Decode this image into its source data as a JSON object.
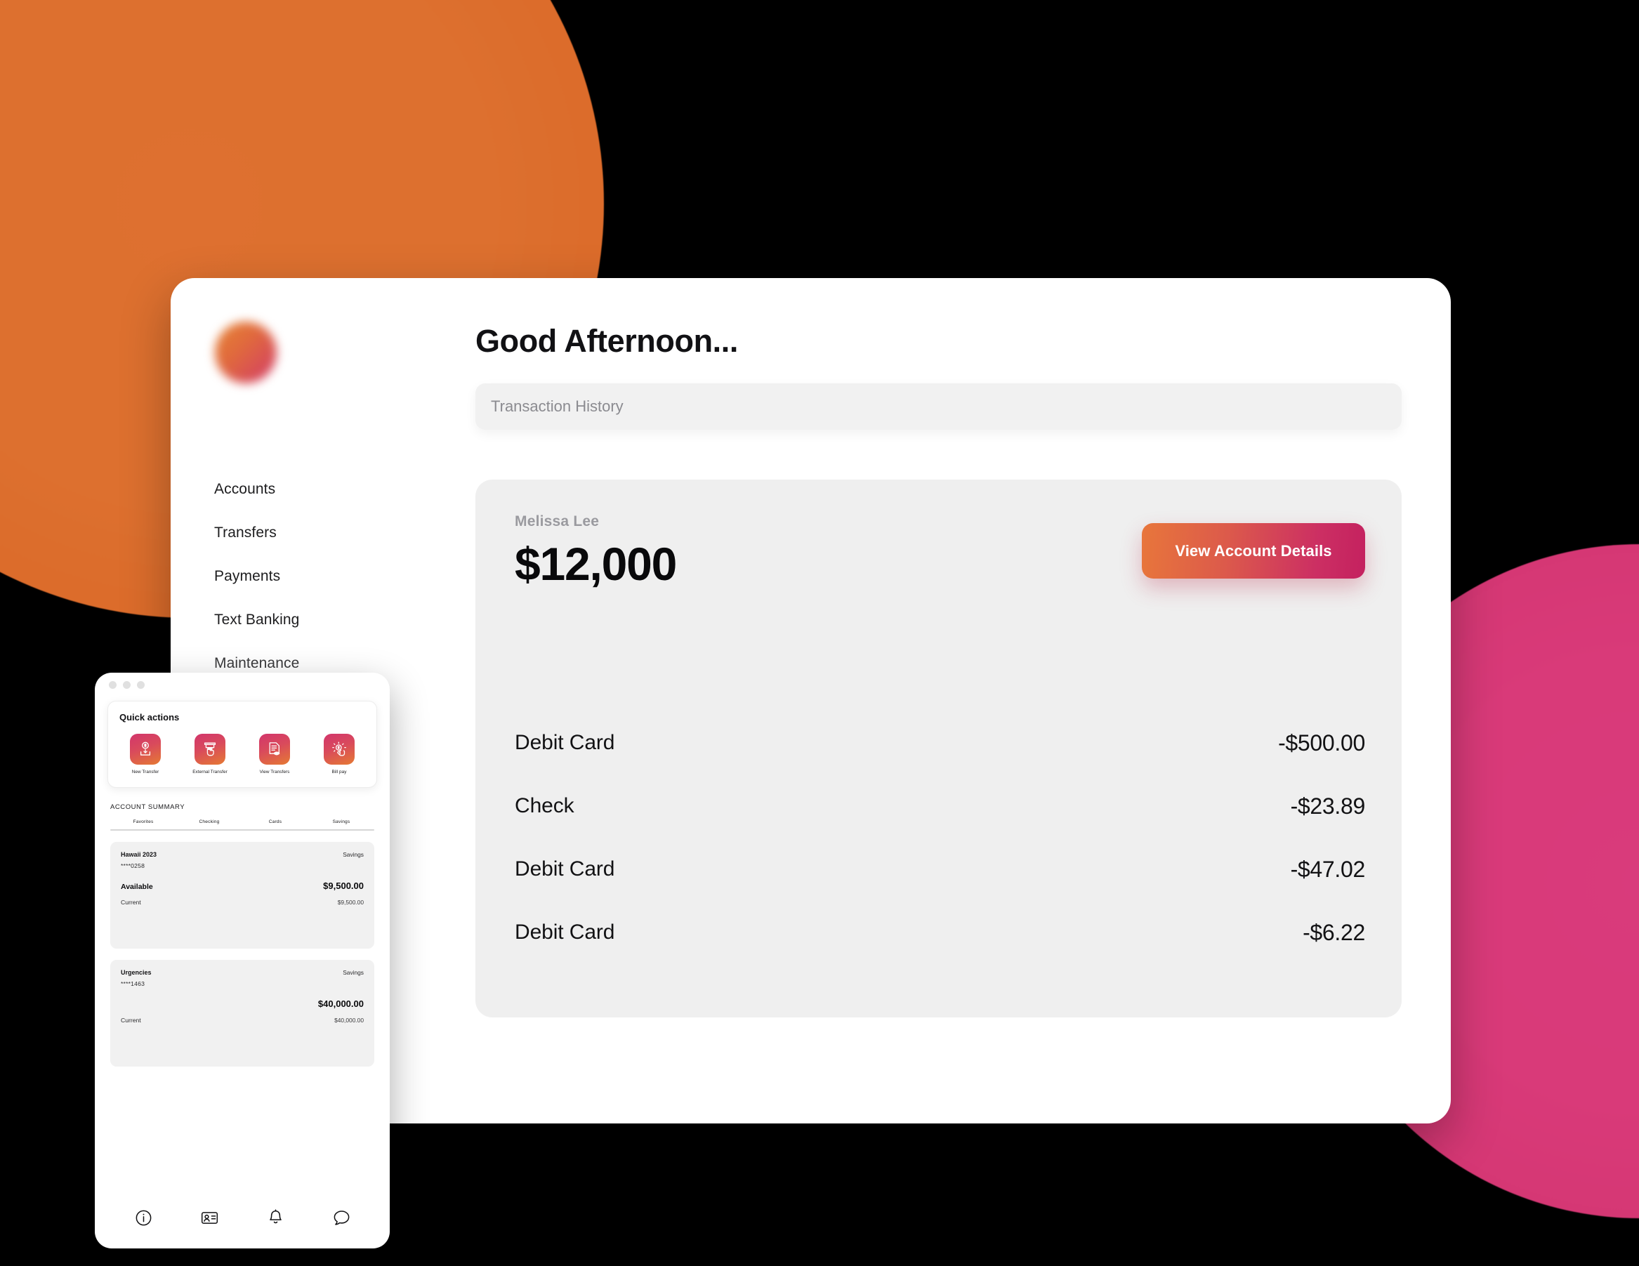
{
  "background": {
    "orange_blob_color": "#DE7030",
    "pink_blob_color": "#D93B7C",
    "page_color": "#000000"
  },
  "desktop": {
    "sidebar": {
      "avatar_name": "brand-avatar",
      "items": [
        {
          "label": "Accounts"
        },
        {
          "label": "Transfers"
        },
        {
          "label": "Payments"
        },
        {
          "label": "Text Banking"
        },
        {
          "label": "Maintenance"
        }
      ]
    },
    "greeting": "Good Afternoon...",
    "search": {
      "placeholder": "Transaction History",
      "value": ""
    },
    "account": {
      "owner": "Melissa Lee",
      "balance": "$12,000",
      "details_button": "View Account Details",
      "button_gradient_from": "#E8763B",
      "button_gradient_to": "#C4215F"
    },
    "transactions": [
      {
        "label": "Debit Card",
        "amount": "-$500.00"
      },
      {
        "label": "Check",
        "amount": "-$23.89"
      },
      {
        "label": "Debit Card",
        "amount": "-$47.02"
      },
      {
        "label": "Debit Card",
        "amount": "-$6.22"
      }
    ]
  },
  "mobile": {
    "quick_actions": {
      "title": "Quick actions",
      "items": [
        {
          "label": "New Transfer",
          "icon": "money-download-icon"
        },
        {
          "label": "External Transfer",
          "icon": "atm-hand-icon"
        },
        {
          "label": "View Transfers",
          "icon": "document-eye-icon"
        },
        {
          "label": "Bill pay",
          "icon": "tap-to-pay-icon"
        }
      ],
      "tile_gradient_from": "#D2356C",
      "tile_gradient_to": "#E57A33"
    },
    "account_summary": {
      "heading": "ACCOUNT SUMMARY",
      "tabs": [
        {
          "label": "Favorites"
        },
        {
          "label": "Checking"
        },
        {
          "label": "Cards"
        },
        {
          "label": "Savings"
        }
      ],
      "accounts": [
        {
          "name": "Hawaii 2023",
          "type": "Savings",
          "mask": "****0258",
          "available_label": "Available",
          "available_value": "$9,500.00",
          "current_label": "Current",
          "current_value": "$9,500.00"
        },
        {
          "name": "Urgencies",
          "type": "Savings",
          "mask": "****1463",
          "available_label": "",
          "available_value": "$40,000.00",
          "current_label": "Current",
          "current_value": "$40,000.00"
        }
      ]
    },
    "bottom_nav": [
      {
        "icon": "info-icon"
      },
      {
        "icon": "contact-card-icon"
      },
      {
        "icon": "bell-icon"
      },
      {
        "icon": "chat-bubble-icon"
      }
    ]
  }
}
